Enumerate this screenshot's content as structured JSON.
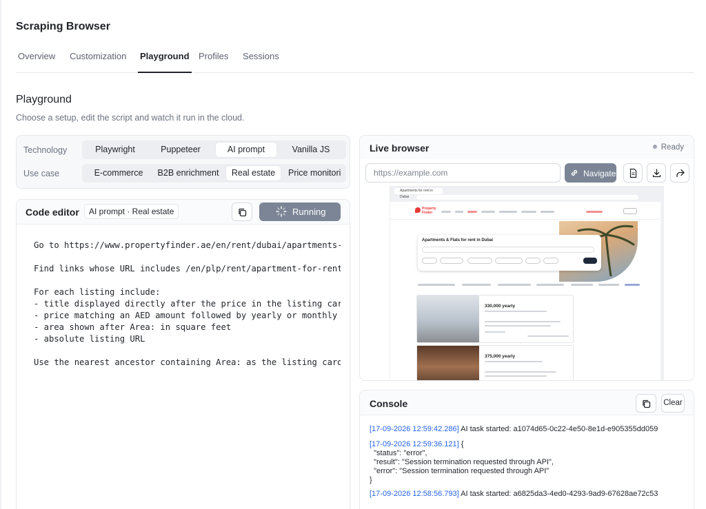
{
  "app": {
    "title": "Scraping Browser"
  },
  "tabs": [
    {
      "label": "Overview"
    },
    {
      "label": "Customization"
    },
    {
      "label": "Playground",
      "active": true
    },
    {
      "label": "Profiles"
    },
    {
      "label": "Sessions"
    }
  ],
  "playground": {
    "title": "Playground",
    "subtitle": "Choose a setup, edit the script and watch it run in the cloud."
  },
  "setup": {
    "technology_label": "Technology",
    "technologies": [
      "Playwright",
      "Puppeteer",
      "AI prompt",
      "Vanilla JS"
    ],
    "technology_selected": "AI prompt",
    "usecase_label": "Use case",
    "usecases": [
      "E-commerce",
      "B2B enrichment",
      "Real estate",
      "Price monitori"
    ],
    "usecase_selected": "Real estate"
  },
  "editor": {
    "title": "Code editor",
    "tag": "AI prompt · Real estate",
    "run_label": "Running",
    "code": "Go to https://www.propertyfinder.ae/en/rent/dubai/apartments-f\n\nFind links whose URL includes /en/plp/rent/apartment-for-rent-\n\nFor each listing include:\n- title displayed directly after the price in the listing card\n- price matching an AED amount followed by yearly or monthly\n- area shown after Area: in square feet\n- absolute listing URL\n\nUse the nearest ancestor containing Area: as the listing card."
  },
  "browser": {
    "title": "Live browser",
    "status": "Ready",
    "url_placeholder": "https://example.com",
    "navigate_label": "Navigate",
    "preview": {
      "tab_title": "Apartments for rent in Dubai",
      "brand": "Property Finder",
      "search_heading": "Apartments & Flats for rent in Dubai",
      "listing_prices": [
        "330,000 yearly",
        "375,000 yearly"
      ]
    }
  },
  "console": {
    "title": "Console",
    "clear_label": "Clear",
    "entries": [
      {
        "ts": "[17-09-2026 12:59:42.286]",
        "text": " AI task started: a1074d65-0c22-4e50-8e1d-e905355dd059"
      },
      {
        "ts": "[17-09-2026 12:59:36.121]",
        "text": " {\n  \"status\": \"error\",\n  \"result\": \"Session termination requested through API\",\n  \"error\": \"Session termination requested through API\"\n}"
      },
      {
        "ts": "[17-09-2026 12:58:56.793]",
        "text": " AI task started: a6825da3-4ed0-4293-9ad9-67628ae72c53"
      }
    ]
  },
  "colors": {
    "accent_button": "#7b8595",
    "timestamp": "#2563eb",
    "brand_red": "#e53935"
  },
  "icons": [
    "copy-icon",
    "spinner-icon",
    "link-icon",
    "document-icon",
    "download-icon",
    "share-icon"
  ]
}
